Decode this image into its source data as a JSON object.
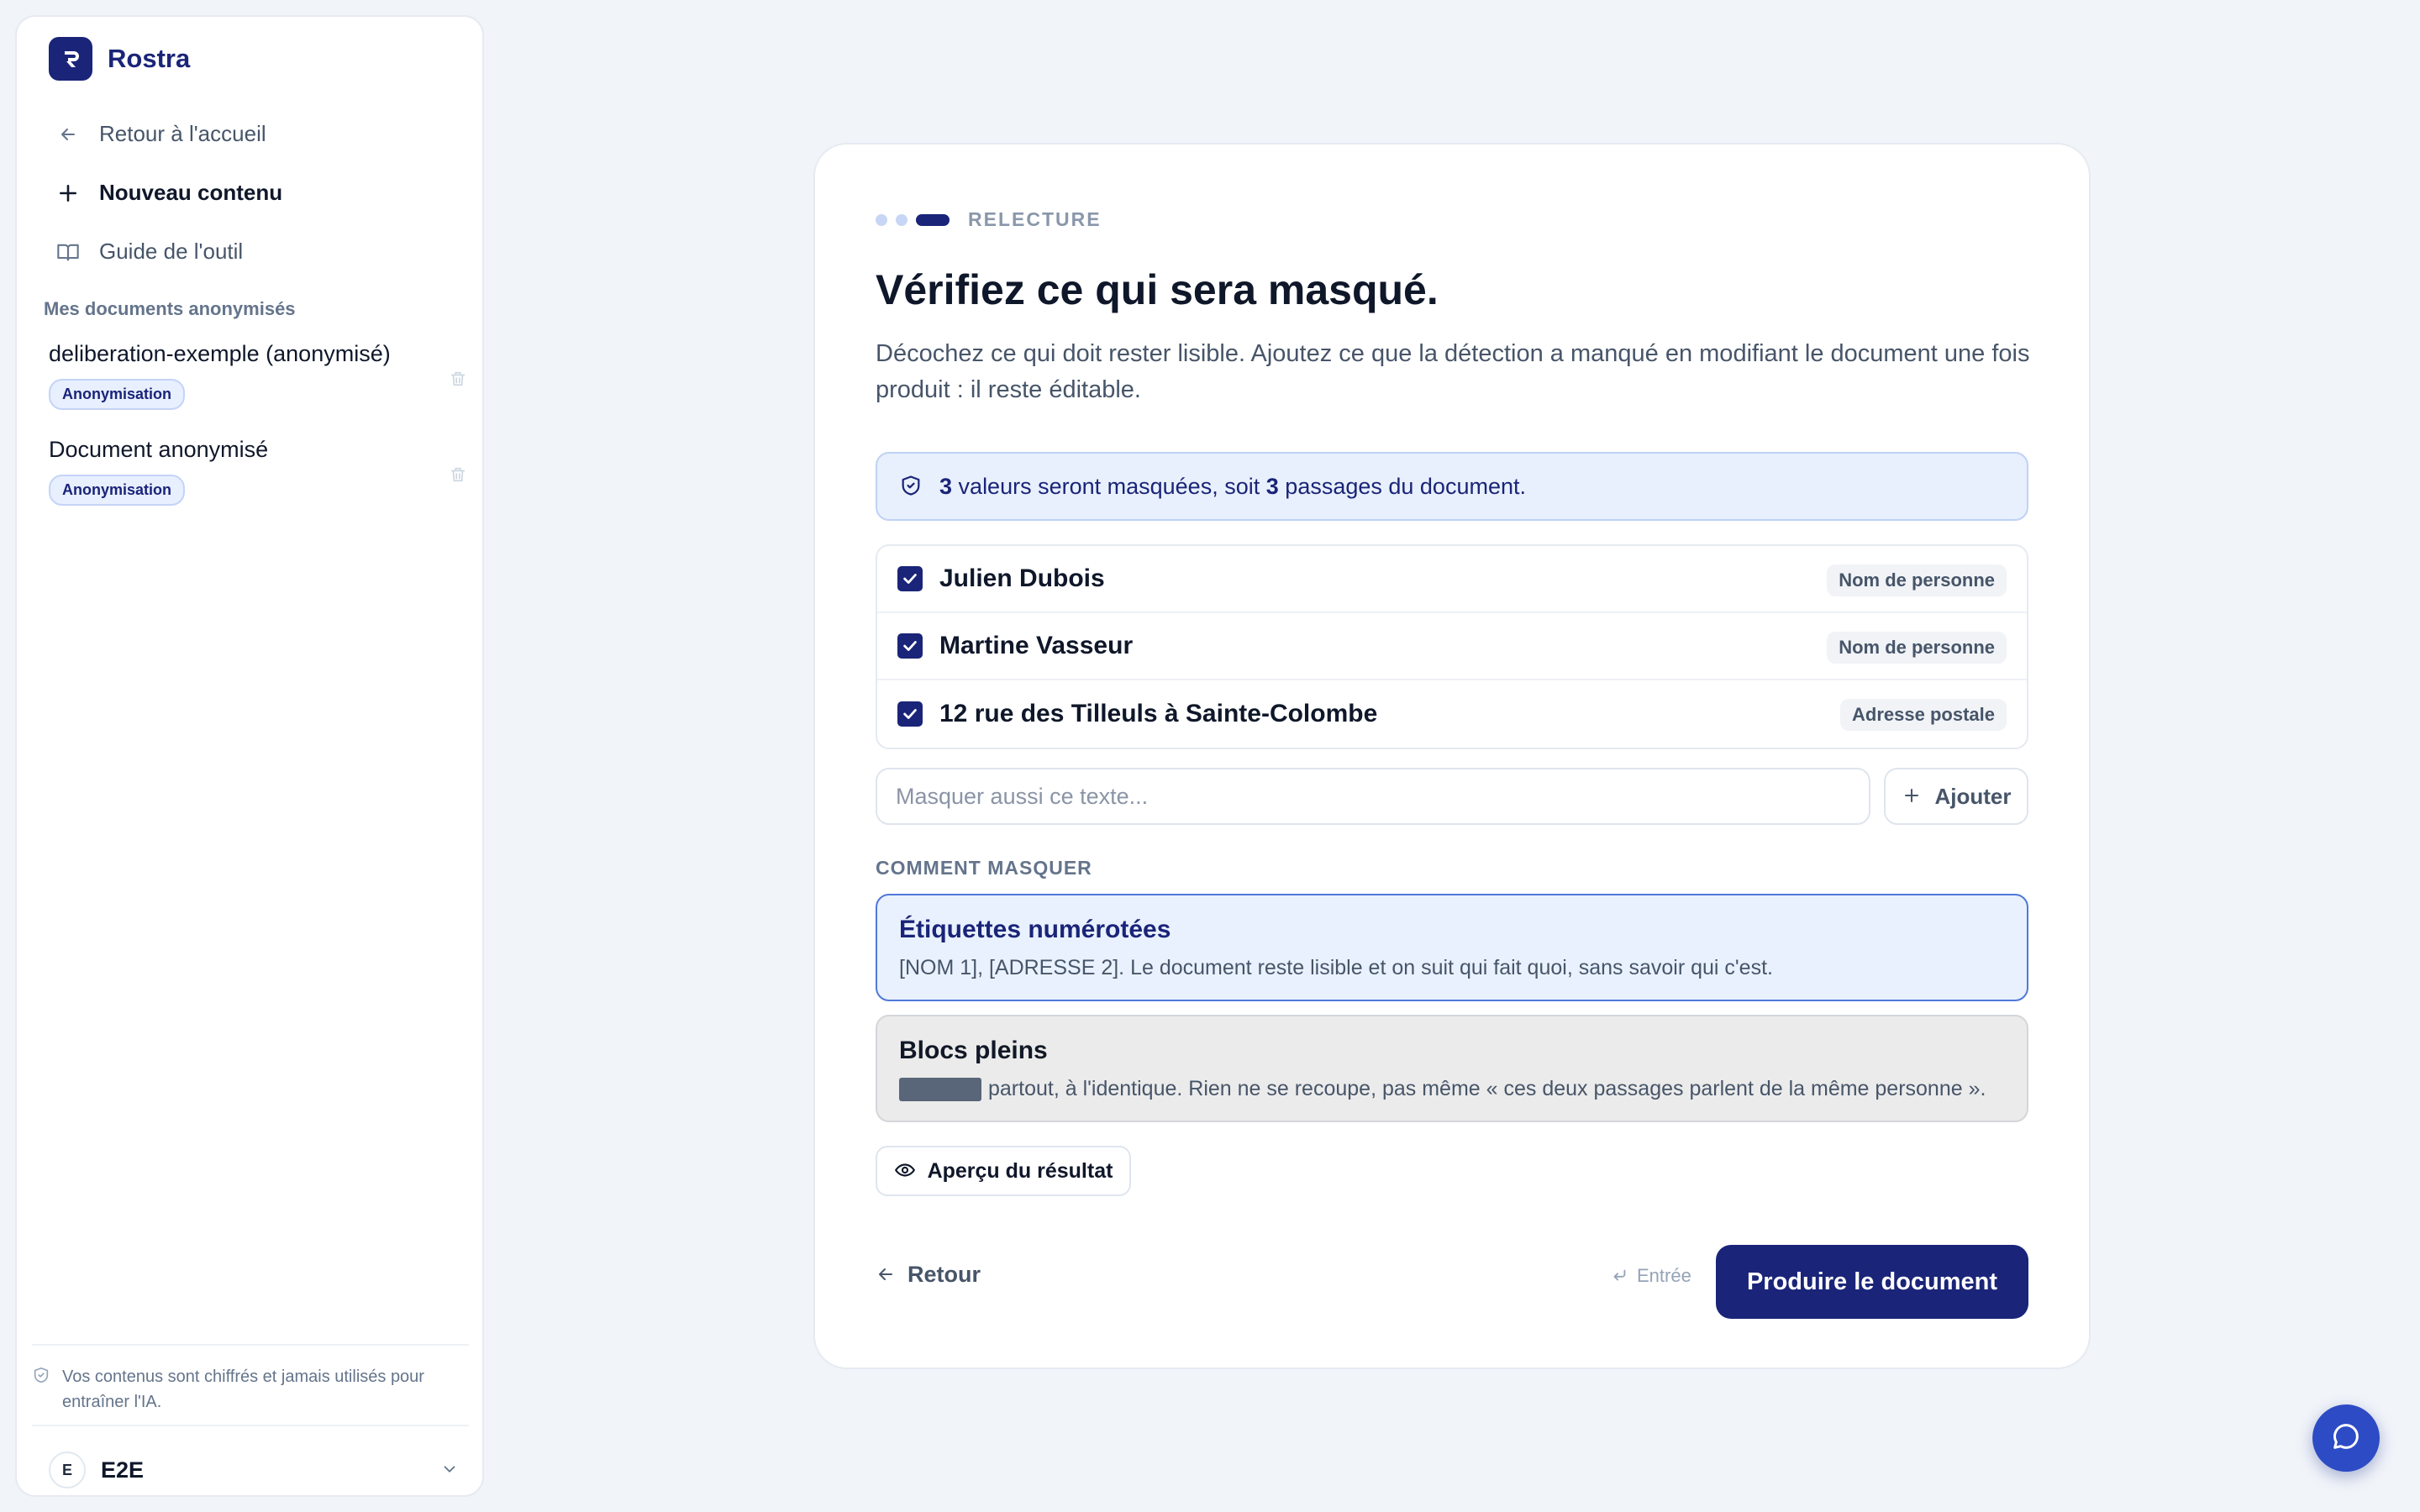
{
  "app": {
    "name": "Rostra",
    "brand_color": "#1a2478",
    "accent_color": "#2d4bc4"
  },
  "sidebar": {
    "nav": [
      {
        "label": "Retour à l'accueil",
        "icon": "arrow-left-icon"
      },
      {
        "label": "Nouveau contenu",
        "icon": "plus-icon"
      },
      {
        "label": "Guide de l'outil",
        "icon": "book-open-icon"
      }
    ],
    "section_title": "Mes documents anonymisés",
    "documents": [
      {
        "title": "deliberation-exemple (anonymisé)",
        "badge": "Anonymisation",
        "action_icon": "trash-icon"
      },
      {
        "title": "Document anonymisé",
        "badge": "Anonymisation",
        "action_icon": "trash-icon"
      }
    ],
    "privacy_note": "Vos contenus sont chiffrés et jamais utilisés pour entraîner l'IA.",
    "user": {
      "initial": "E",
      "name": "E2E",
      "menu_icon": "chevron-down-icon"
    }
  },
  "main": {
    "step_label": "RELECTURE",
    "step_progress": {
      "current": 3,
      "total": 3
    },
    "title": "Vérifiez ce qui sera masqué.",
    "description": "Décochez ce qui doit rester lisible. Ajoutez ce que la détection a manqué en modifiant le document une fois produit : il reste éditable.",
    "notice": {
      "count_values": "3",
      "text_values": "valeurs seront masquées, soit",
      "count_passages": "3",
      "text_passages": "passages du document."
    },
    "entities": [
      {
        "name": "Julien Dubois",
        "type": "Nom de personne",
        "checked": true
      },
      {
        "name": "Martine Vasseur",
        "type": "Nom de personne",
        "checked": true
      },
      {
        "name": "12 rue des Tilleuls à Sainte-Colombe",
        "type": "Adresse postale",
        "checked": true
      }
    ],
    "add_input": {
      "placeholder": "Masquer aussi ce texte...",
      "value": ""
    },
    "add_button": "Ajouter",
    "mask_section_title": "COMMENT MASQUER",
    "mask_options": [
      {
        "title": "Étiquettes numérotées",
        "description": "[NOM 1], [ADRESSE 2]. Le document reste lisible et on suit qui fait quoi, sans savoir qui c'est.",
        "selected": true
      },
      {
        "title": "Blocs pleins",
        "description": "partout, à l'identique. Rien ne se recoupe, pas même « ces deux passages parlent de la même personne ».",
        "selected": false
      }
    ],
    "preview_button": "Aperçu du résultat",
    "back_button": "Retour",
    "keyboard_hint": "Entrée",
    "primary_button": "Produire le document"
  },
  "chat": {
    "icon": "chat-bubble-icon"
  }
}
